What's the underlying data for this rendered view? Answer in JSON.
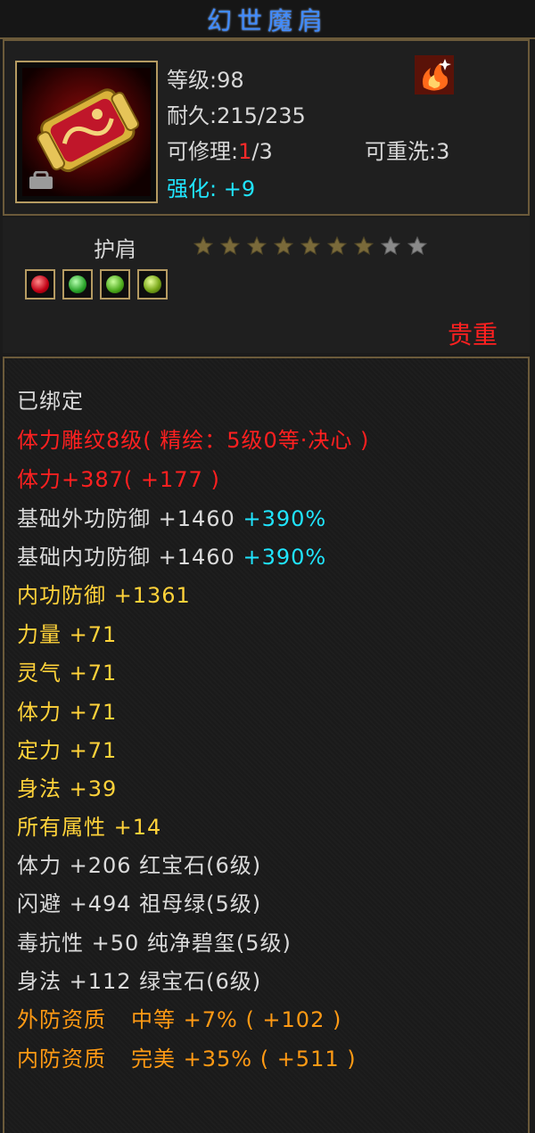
{
  "title": "幻世魔肩",
  "header": {
    "level_label": "等级",
    "level_value": ":98",
    "durability_label": "耐久",
    "durability_value": ":215/235",
    "repair_label": "可修理:",
    "repair_used": "1",
    "repair_total": "/3",
    "rewash_label": "可重洗:",
    "rewash_value": "3",
    "enhance_label": "强化:",
    "enhance_value": "+9"
  },
  "slot": {
    "name": "护肩",
    "stars_filled": 7,
    "stars_total": 9,
    "rarity": "贵重"
  },
  "gems": [
    "red-gem-icon",
    "green-gem-icon",
    "green-gem-icon",
    "jade-gem-icon"
  ],
  "colors": {
    "title": "#3f8bff",
    "red": "#ff2020",
    "yellow": "#ffd23a",
    "orange": "#ff9a14",
    "cyan": "#20e5ff",
    "white": "#dadada",
    "gold_border": "#b59b62"
  },
  "stats": {
    "bound": "已绑定",
    "engrave": "体力雕纹8级( 精绘：5级0等·决心 )",
    "vit_engrave": "体力+387( +177 )",
    "base_ext_def": "基础外功防御 +1460",
    "base_ext_def_pct": "+390%",
    "base_int_def": "基础内功防御 +1460",
    "base_int_def_pct": "+390%",
    "int_def": "内功防御 +1361",
    "strength": "力量 +71",
    "spirit": "灵气 +71",
    "vitality": "体力 +71",
    "focus": "定力 +71",
    "agility": "身法 +39",
    "all_attr": "所有属性 +14",
    "gem_vit": "体力 +206 红宝石(6级)",
    "gem_dodge": "闪避 +494 祖母绿(5级)",
    "gem_poison": "毒抗性 +50 纯净碧玺(5级)",
    "gem_agi": "身法 +112 绿宝石(6级)",
    "ext_quality_label": "外防资质",
    "ext_quality_value": "中等 +7% ( +102 )",
    "int_quality_label": "内防资质",
    "int_quality_value": "完美 +35% ( +511 )"
  }
}
